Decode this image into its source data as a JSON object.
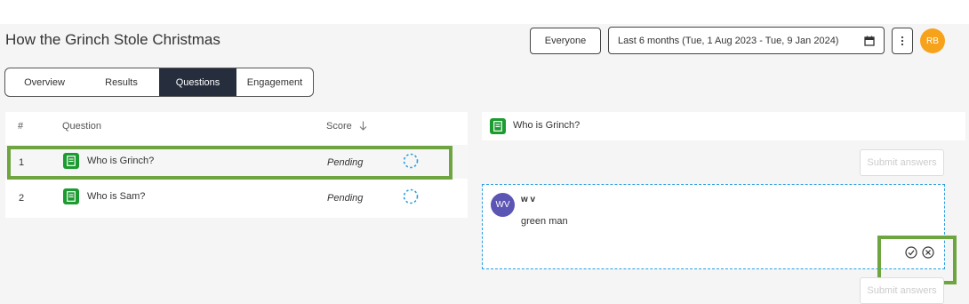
{
  "page": {
    "title": "How the Grinch Stole Christmas"
  },
  "header": {
    "audience_label": "Everyone",
    "date_range": "Last 6 months (Tue, 1 Aug 2023 - Tue, 9 Jan 2024)",
    "user_initials": "RB"
  },
  "tabs": [
    {
      "label": "Overview",
      "active": false
    },
    {
      "label": "Results",
      "active": false
    },
    {
      "label": "Questions",
      "active": true
    },
    {
      "label": "Engagement",
      "active": false
    }
  ],
  "questions_table": {
    "columns": {
      "number": "#",
      "question": "Question",
      "score": "Score"
    },
    "rows": [
      {
        "number": "1",
        "question": "Who is Grinch?",
        "score": "Pending"
      },
      {
        "number": "2",
        "question": "Who is Sam?",
        "score": "Pending"
      }
    ]
  },
  "detail": {
    "question": "Who is Grinch?",
    "submit_label": "Submit answers",
    "answer": {
      "initials": "WV",
      "user": "w v",
      "text": "green man"
    }
  },
  "colors": {
    "active_tab": "#262d3d",
    "question_icon": "#1c9b30",
    "avatar_rb": "#f7a21b",
    "avatar_wv": "#5b55b3",
    "highlight": "#6fa540",
    "answer_border": "#2a9de0"
  },
  "icons": {
    "calendar": "calendar-icon",
    "more": "more-vertical-icon",
    "sort": "arrow-down-icon",
    "question": "document-icon",
    "pending": "pending-spinner-icon",
    "approve": "check-circle-icon",
    "reject": "x-circle-icon"
  }
}
